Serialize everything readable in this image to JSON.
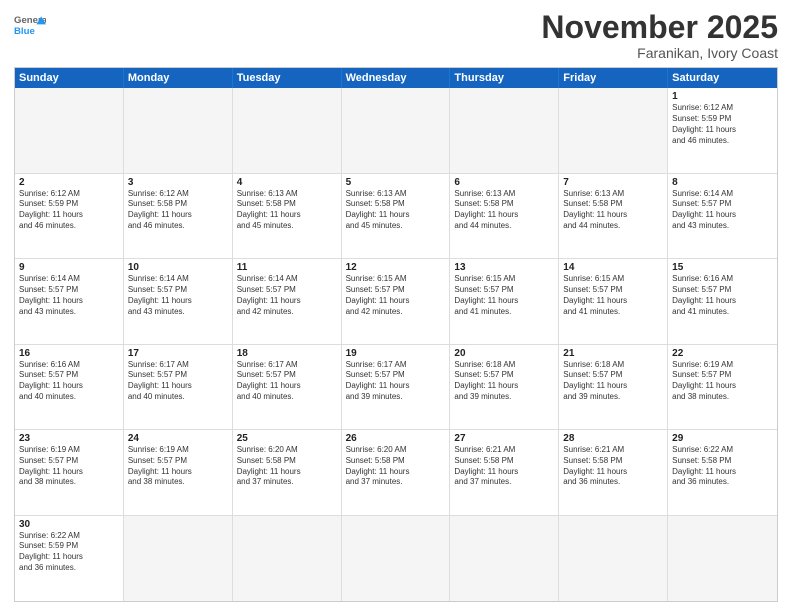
{
  "header": {
    "logo_general": "General",
    "logo_blue": "Blue",
    "month_title": "November 2025",
    "subtitle": "Faranikan, Ivory Coast"
  },
  "weekdays": [
    "Sunday",
    "Monday",
    "Tuesday",
    "Wednesday",
    "Thursday",
    "Friday",
    "Saturday"
  ],
  "rows": [
    [
      {
        "day": "",
        "info": ""
      },
      {
        "day": "",
        "info": ""
      },
      {
        "day": "",
        "info": ""
      },
      {
        "day": "",
        "info": ""
      },
      {
        "day": "",
        "info": ""
      },
      {
        "day": "",
        "info": ""
      },
      {
        "day": "1",
        "info": "Sunrise: 6:12 AM\nSunset: 5:59 PM\nDaylight: 11 hours\nand 46 minutes."
      }
    ],
    [
      {
        "day": "2",
        "info": "Sunrise: 6:12 AM\nSunset: 5:59 PM\nDaylight: 11 hours\nand 46 minutes."
      },
      {
        "day": "3",
        "info": "Sunrise: 6:12 AM\nSunset: 5:58 PM\nDaylight: 11 hours\nand 46 minutes."
      },
      {
        "day": "4",
        "info": "Sunrise: 6:13 AM\nSunset: 5:58 PM\nDaylight: 11 hours\nand 45 minutes."
      },
      {
        "day": "5",
        "info": "Sunrise: 6:13 AM\nSunset: 5:58 PM\nDaylight: 11 hours\nand 45 minutes."
      },
      {
        "day": "6",
        "info": "Sunrise: 6:13 AM\nSunset: 5:58 PM\nDaylight: 11 hours\nand 44 minutes."
      },
      {
        "day": "7",
        "info": "Sunrise: 6:13 AM\nSunset: 5:58 PM\nDaylight: 11 hours\nand 44 minutes."
      },
      {
        "day": "8",
        "info": "Sunrise: 6:14 AM\nSunset: 5:57 PM\nDaylight: 11 hours\nand 43 minutes."
      }
    ],
    [
      {
        "day": "9",
        "info": "Sunrise: 6:14 AM\nSunset: 5:57 PM\nDaylight: 11 hours\nand 43 minutes."
      },
      {
        "day": "10",
        "info": "Sunrise: 6:14 AM\nSunset: 5:57 PM\nDaylight: 11 hours\nand 43 minutes."
      },
      {
        "day": "11",
        "info": "Sunrise: 6:14 AM\nSunset: 5:57 PM\nDaylight: 11 hours\nand 42 minutes."
      },
      {
        "day": "12",
        "info": "Sunrise: 6:15 AM\nSunset: 5:57 PM\nDaylight: 11 hours\nand 42 minutes."
      },
      {
        "day": "13",
        "info": "Sunrise: 6:15 AM\nSunset: 5:57 PM\nDaylight: 11 hours\nand 41 minutes."
      },
      {
        "day": "14",
        "info": "Sunrise: 6:15 AM\nSunset: 5:57 PM\nDaylight: 11 hours\nand 41 minutes."
      },
      {
        "day": "15",
        "info": "Sunrise: 6:16 AM\nSunset: 5:57 PM\nDaylight: 11 hours\nand 41 minutes."
      }
    ],
    [
      {
        "day": "16",
        "info": "Sunrise: 6:16 AM\nSunset: 5:57 PM\nDaylight: 11 hours\nand 40 minutes."
      },
      {
        "day": "17",
        "info": "Sunrise: 6:17 AM\nSunset: 5:57 PM\nDaylight: 11 hours\nand 40 minutes."
      },
      {
        "day": "18",
        "info": "Sunrise: 6:17 AM\nSunset: 5:57 PM\nDaylight: 11 hours\nand 40 minutes."
      },
      {
        "day": "19",
        "info": "Sunrise: 6:17 AM\nSunset: 5:57 PM\nDaylight: 11 hours\nand 39 minutes."
      },
      {
        "day": "20",
        "info": "Sunrise: 6:18 AM\nSunset: 5:57 PM\nDaylight: 11 hours\nand 39 minutes."
      },
      {
        "day": "21",
        "info": "Sunrise: 6:18 AM\nSunset: 5:57 PM\nDaylight: 11 hours\nand 39 minutes."
      },
      {
        "day": "22",
        "info": "Sunrise: 6:19 AM\nSunset: 5:57 PM\nDaylight: 11 hours\nand 38 minutes."
      }
    ],
    [
      {
        "day": "23",
        "info": "Sunrise: 6:19 AM\nSunset: 5:57 PM\nDaylight: 11 hours\nand 38 minutes."
      },
      {
        "day": "24",
        "info": "Sunrise: 6:19 AM\nSunset: 5:57 PM\nDaylight: 11 hours\nand 38 minutes."
      },
      {
        "day": "25",
        "info": "Sunrise: 6:20 AM\nSunset: 5:58 PM\nDaylight: 11 hours\nand 37 minutes."
      },
      {
        "day": "26",
        "info": "Sunrise: 6:20 AM\nSunset: 5:58 PM\nDaylight: 11 hours\nand 37 minutes."
      },
      {
        "day": "27",
        "info": "Sunrise: 6:21 AM\nSunset: 5:58 PM\nDaylight: 11 hours\nand 37 minutes."
      },
      {
        "day": "28",
        "info": "Sunrise: 6:21 AM\nSunset: 5:58 PM\nDaylight: 11 hours\nand 36 minutes."
      },
      {
        "day": "29",
        "info": "Sunrise: 6:22 AM\nSunset: 5:58 PM\nDaylight: 11 hours\nand 36 minutes."
      }
    ],
    [
      {
        "day": "30",
        "info": "Sunrise: 6:22 AM\nSunset: 5:59 PM\nDaylight: 11 hours\nand 36 minutes."
      },
      {
        "day": "",
        "info": ""
      },
      {
        "day": "",
        "info": ""
      },
      {
        "day": "",
        "info": ""
      },
      {
        "day": "",
        "info": ""
      },
      {
        "day": "",
        "info": ""
      },
      {
        "day": "",
        "info": ""
      }
    ]
  ]
}
